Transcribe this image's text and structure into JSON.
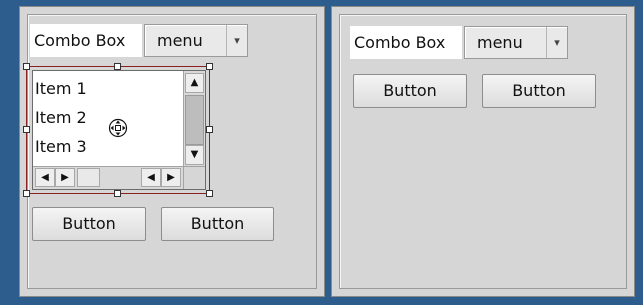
{
  "left_panel": {
    "combo_label": "Combo Box",
    "combo_value": "menu",
    "combo_arrow": "▾",
    "list_items": [
      "Item 1",
      "Item 2",
      "Item 3"
    ],
    "vscroll_up": "▲",
    "vscroll_down": "▼",
    "hscroll_left": "◀",
    "hscroll_right": "▶",
    "hscroll_left2": "◀",
    "hscroll_right2": "▶",
    "button1": "Button",
    "button2": "Button"
  },
  "right_panel": {
    "combo_label": "Combo Box",
    "combo_value": "menu",
    "combo_arrow": "▾",
    "button1": "Button",
    "button2": "Button"
  },
  "colors": {
    "desktop": "#2d5d8c",
    "panel": "#d6d6d6",
    "selection_frame": "#8a1f1f"
  },
  "icons": {
    "move_cursor": "move-cursor-icon"
  }
}
